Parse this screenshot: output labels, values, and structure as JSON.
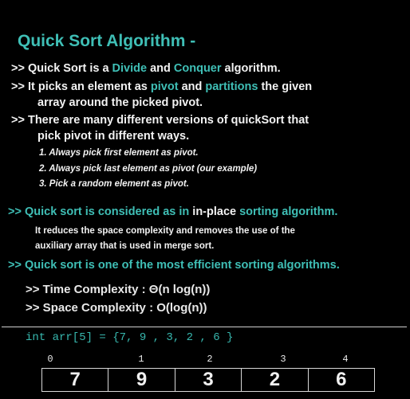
{
  "title": "Quick Sort Algorithm -",
  "colors": {
    "background": "#000000",
    "accent": "#3fbfb6",
    "text": "#f2f2f2"
  },
  "points": [
    {
      "prefix": ">> ",
      "parts": [
        "Quick Sort is a ",
        "Divide",
        " and ",
        "Conquer",
        " algorithm."
      ]
    },
    {
      "prefix": ">> ",
      "parts": [
        "It picks an element as ",
        "pivot",
        " and ",
        "partitions",
        " the given"
      ],
      "cont": "array around the picked pivot."
    },
    {
      "prefix": ">> ",
      "parts": [
        "There are many different versions of quickSort that"
      ],
      "cont": "pick pivot in different ways."
    }
  ],
  "options": [
    "1. Always pick first element as pivot.",
    "2. Always pick last element as pivot (our example)",
    "3. Pick a random element as pivot."
  ],
  "inplace": {
    "a": ">> Quick sort is considered as in ",
    "b": "in-place",
    "c": " sorting algorithm."
  },
  "inplace_desc": [
    "It reduces the space complexity and removes the use of the",
    "auxiliary array that is used in merge sort."
  ],
  "efficient": ">> Quick sort is one of the most efficient sorting algorithms.",
  "complexity": {
    "time": ">> Time Complexity : Θ(n log(n))",
    "space": ">> Space Complexity : O(log(n))"
  },
  "code": "int arr[5] = {7, 9 , 3, 2 , 6 }",
  "array": {
    "indices": [
      "0",
      "1",
      "2",
      "3",
      "4"
    ],
    "values": [
      "7",
      "9",
      "3",
      "2",
      "6"
    ]
  }
}
